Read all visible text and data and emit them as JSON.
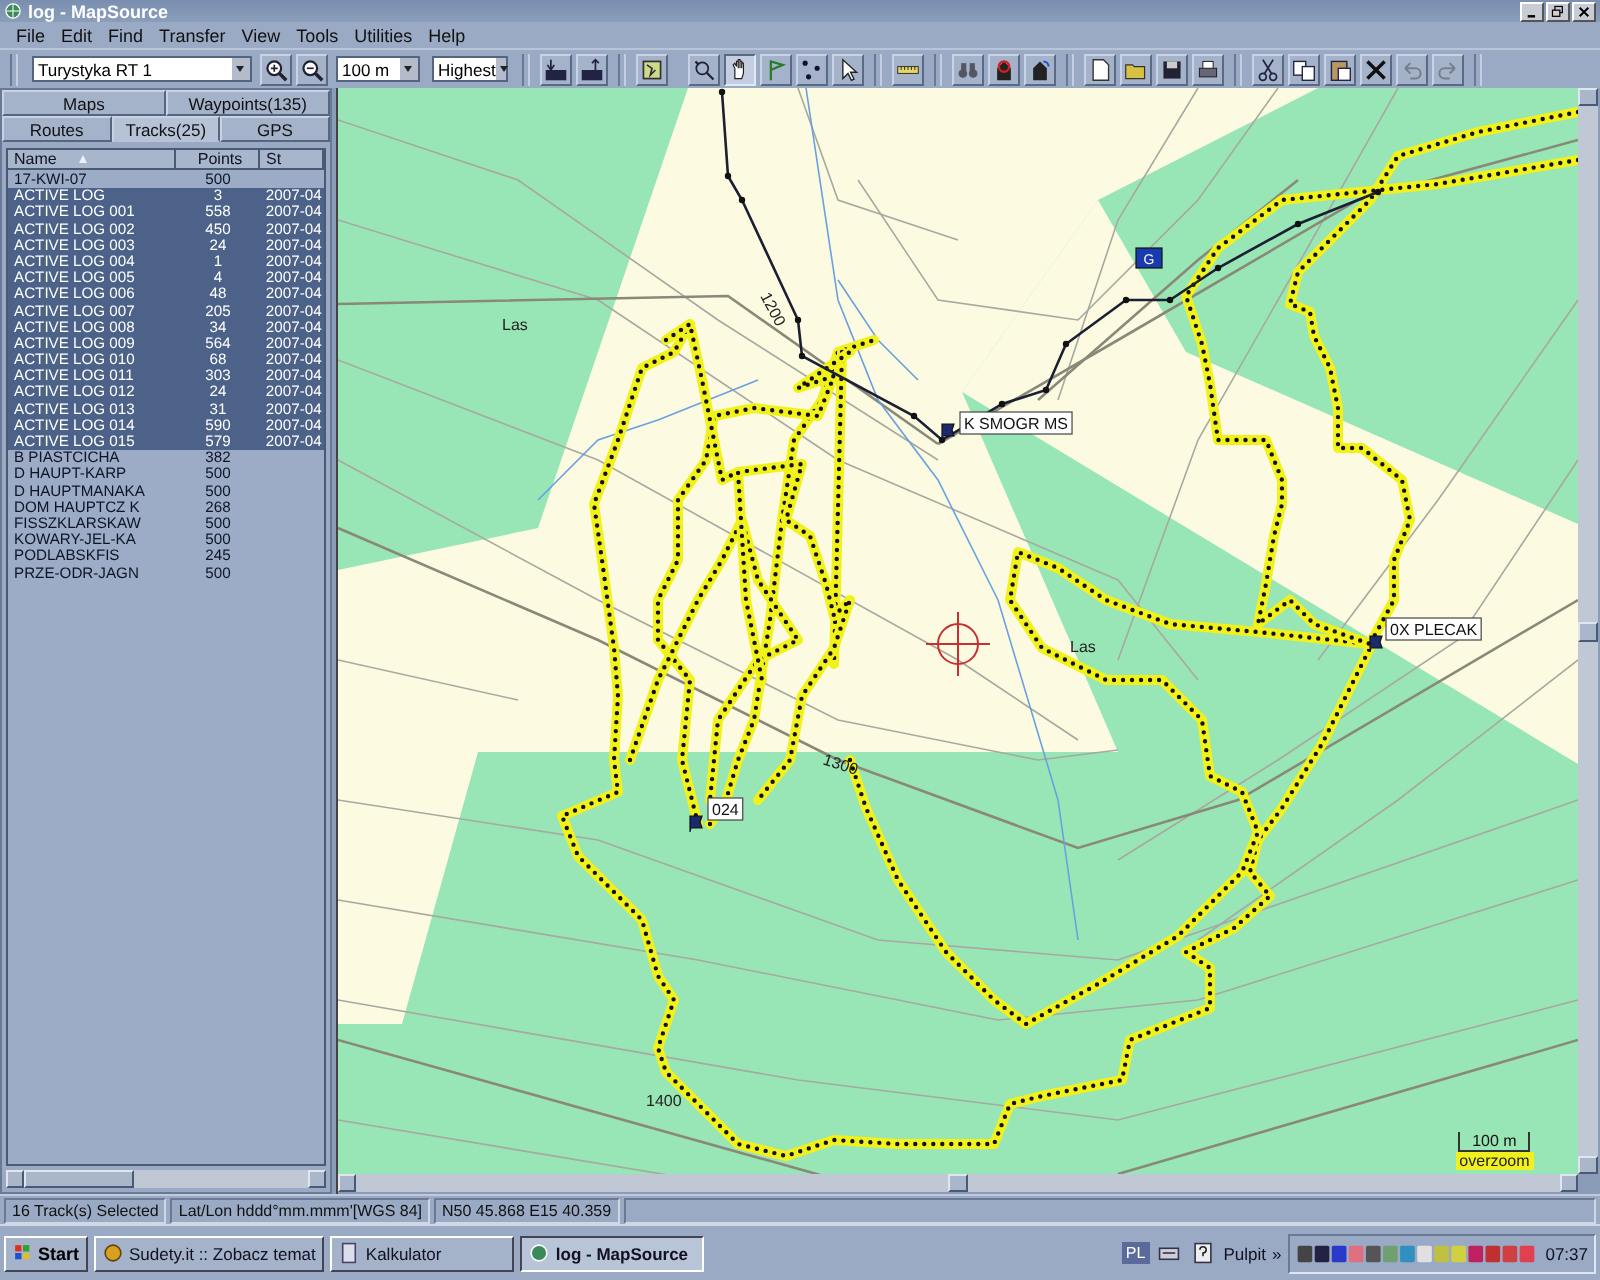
{
  "window": {
    "title": "log - MapSource"
  },
  "menu": [
    "File",
    "Edit",
    "Find",
    "Transfer",
    "View",
    "Tools",
    "Utilities",
    "Help"
  ],
  "toolbar": {
    "map_product": "Turystyka RT 1",
    "zoom_scale": "100 m",
    "detail": "Highest",
    "tools": [
      {
        "kind": "map",
        "selected": false
      },
      {
        "kind": "zoom",
        "selected": false
      },
      {
        "kind": "hand",
        "selected": true
      },
      {
        "kind": "route",
        "selected": false
      },
      {
        "kind": "waypoint",
        "selected": false
      },
      {
        "kind": "select",
        "selected": false
      }
    ],
    "edit_buttons": [
      {
        "kind": "cut",
        "disabled": false
      },
      {
        "kind": "copy",
        "disabled": false
      },
      {
        "kind": "paste",
        "disabled": false
      },
      {
        "kind": "delete",
        "disabled": false
      },
      {
        "kind": "undo",
        "disabled": true
      },
      {
        "kind": "redo",
        "disabled": true
      }
    ]
  },
  "sidebar": {
    "tab_rows": [
      {
        "tabs": [
          {
            "label": "Maps",
            "selected": false
          },
          {
            "label": "Waypoints(135)",
            "selected": false
          }
        ]
      },
      {
        "tabs": [
          {
            "label": "Routes",
            "selected": false
          },
          {
            "label": "Tracks(25)",
            "selected": true
          },
          {
            "label": "GPS",
            "selected": false
          }
        ]
      }
    ],
    "columns": [
      {
        "label": "Name",
        "sorted_ascending": true
      },
      {
        "label": "Points"
      },
      {
        "label": "St"
      }
    ],
    "rows": [
      {
        "name": "17-KWI-07",
        "points": "500",
        "selected": false
      },
      {
        "name": "ACTIVE LOG",
        "points": "3",
        "start": "2007-04",
        "selected": true
      },
      {
        "name": "ACTIVE LOG 001",
        "points": "558",
        "start": "2007-04",
        "selected": true
      },
      {
        "name": "ACTIVE LOG 002",
        "points": "450",
        "start": "2007-04",
        "selected": true
      },
      {
        "name": "ACTIVE LOG 003",
        "points": "24",
        "start": "2007-04",
        "selected": true
      },
      {
        "name": "ACTIVE LOG 004",
        "points": "1",
        "start": "2007-04",
        "selected": true
      },
      {
        "name": "ACTIVE LOG 005",
        "points": "4",
        "start": "2007-04",
        "selected": true
      },
      {
        "name": "ACTIVE LOG 006",
        "points": "48",
        "start": "2007-04",
        "selected": true
      },
      {
        "name": "ACTIVE LOG 007",
        "points": "205",
        "start": "2007-04",
        "selected": true
      },
      {
        "name": "ACTIVE LOG 008",
        "points": "34",
        "start": "2007-04",
        "selected": true
      },
      {
        "name": "ACTIVE LOG 009",
        "points": "564",
        "start": "2007-04",
        "selected": true
      },
      {
        "name": "ACTIVE LOG 010",
        "points": "68",
        "start": "2007-04",
        "selected": true
      },
      {
        "name": "ACTIVE LOG 011",
        "points": "303",
        "start": "2007-04",
        "selected": true
      },
      {
        "name": "ACTIVE LOG 012",
        "points": "24",
        "start": "2007-04",
        "selected": true
      },
      {
        "name": "ACTIVE LOG 013",
        "points": "31",
        "start": "2007-04",
        "selected": true
      },
      {
        "name": "ACTIVE LOG 014",
        "points": "590",
        "start": "2007-04",
        "selected": true
      },
      {
        "name": "ACTIVE LOG 015",
        "points": "579",
        "start": "2007-04",
        "selected": true
      },
      {
        "name": "B PIASTCICHA",
        "points": "382",
        "selected": false
      },
      {
        "name": "D HAUPT-KARP",
        "points": "500",
        "selected": false
      },
      {
        "name": "D HAUPTMANAKA",
        "points": "500",
        "selected": false
      },
      {
        "name": "DOM HAUPTCZ K",
        "points": "268",
        "selected": false
      },
      {
        "name": "FISSZKLARSKAW",
        "points": "500",
        "selected": false
      },
      {
        "name": "KOWARY-JEL-KA",
        "points": "500",
        "selected": false
      },
      {
        "name": "PODLABSKFIS",
        "points": "245",
        "selected": false
      },
      {
        "name": "PRZE-ODR-JAGN",
        "points": "500",
        "selected": false
      }
    ]
  },
  "map": {
    "labels": [
      {
        "kind": "area",
        "text": "Las"
      },
      {
        "kind": "contour",
        "text": "1200"
      },
      {
        "kind": "waypoint",
        "text": "K SMOGR MS"
      },
      {
        "kind": "sign",
        "text": "G"
      },
      {
        "kind": "area",
        "text": "Las"
      },
      {
        "kind": "waypoint",
        "text": "0X PLECAK"
      },
      {
        "kind": "contour",
        "text": "1300"
      },
      {
        "kind": "waypoint",
        "text": "024"
      },
      {
        "kind": "contour",
        "text": "1400"
      }
    ],
    "scale": "100 m",
    "overzoom": "overzoom"
  },
  "status_bar": [
    "16 Track(s) Selected",
    "Lat/Lon hddd°mm.mmm'[WGS 84]",
    "N50 45.868 E15 40.359"
  ],
  "taskbar": {
    "start": "Start",
    "tasks": [
      {
        "label": "Sudety.it :: Zobacz temat",
        "selected": false
      },
      {
        "label": "Kalkulator",
        "selected": false
      },
      {
        "label": "log - MapSource",
        "selected": true
      }
    ],
    "language": "PL",
    "desktop": "Pulpit",
    "more": "»",
    "clock": "07:37"
  }
}
